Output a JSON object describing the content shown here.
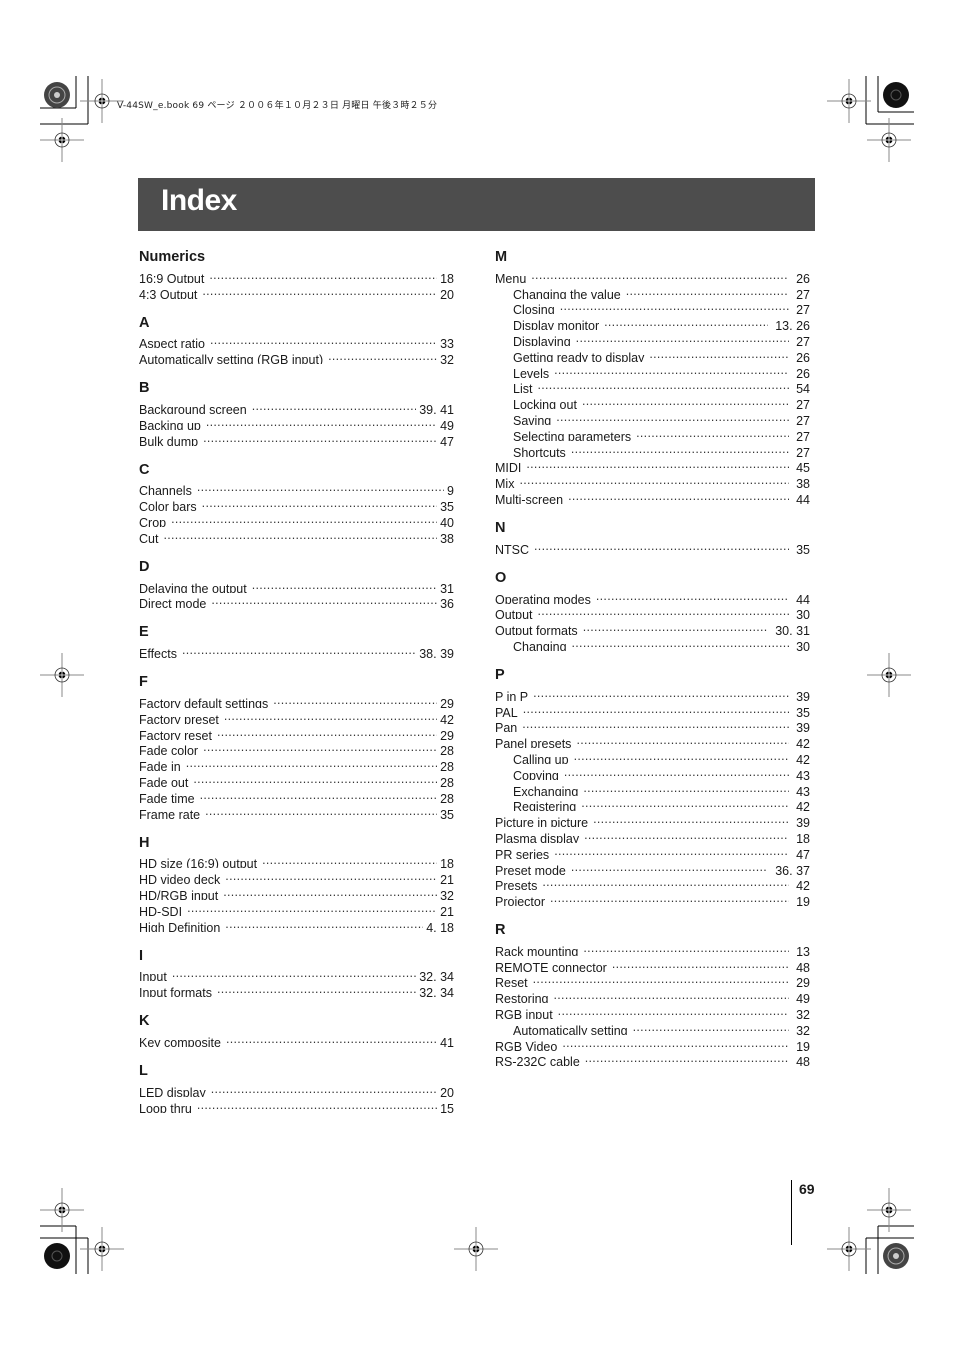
{
  "print_slug": "V-44SW_e.book  69 ページ  ２００６年１０月２３日  月曜日  午後３時２５分",
  "header": {
    "title": "Index"
  },
  "page_number": "69",
  "left_column": [
    {
      "heading": "Numerics",
      "entries": [
        {
          "term": "16:9 Output",
          "pages": "18",
          "sub": false
        },
        {
          "term": "4:3 Output",
          "pages": "20",
          "sub": false
        }
      ]
    },
    {
      "heading": "A",
      "entries": [
        {
          "term": "Aspect ratio",
          "pages": "33",
          "sub": false
        },
        {
          "term": "Automatically setting (RGB input)",
          "pages": "32",
          "sub": false
        }
      ]
    },
    {
      "heading": "B",
      "entries": [
        {
          "term": "Background screen",
          "pages": "39, 41",
          "sub": false
        },
        {
          "term": "Backing up",
          "pages": "49",
          "sub": false
        },
        {
          "term": "Bulk dump",
          "pages": "47",
          "sub": false
        }
      ]
    },
    {
      "heading": "C",
      "entries": [
        {
          "term": "Channels",
          "pages": "9",
          "sub": false
        },
        {
          "term": "Color bars",
          "pages": "35",
          "sub": false
        },
        {
          "term": "Crop",
          "pages": "40",
          "sub": false
        },
        {
          "term": "Cut",
          "pages": "38",
          "sub": false
        }
      ]
    },
    {
      "heading": "D",
      "entries": [
        {
          "term": "Delaying the output",
          "pages": "31",
          "sub": false
        },
        {
          "term": "Direct mode",
          "pages": "36",
          "sub": false
        }
      ]
    },
    {
      "heading": "E",
      "entries": [
        {
          "term": "Effects",
          "pages": "38, 39",
          "sub": false
        }
      ]
    },
    {
      "heading": "F",
      "entries": [
        {
          "term": "Factory default settings",
          "pages": "29",
          "sub": false
        },
        {
          "term": "Factory preset",
          "pages": "42",
          "sub": false
        },
        {
          "term": "Factory reset",
          "pages": "29",
          "sub": false
        },
        {
          "term": "Fade color",
          "pages": "28",
          "sub": false
        },
        {
          "term": "Fade in",
          "pages": "28",
          "sub": false
        },
        {
          "term": "Fade out",
          "pages": "28",
          "sub": false
        },
        {
          "term": "Fade time",
          "pages": "28",
          "sub": false
        },
        {
          "term": "Frame rate",
          "pages": "35",
          "sub": false
        }
      ]
    },
    {
      "heading": "H",
      "entries": [
        {
          "term": "HD size (16:9) output",
          "pages": "18",
          "sub": false
        },
        {
          "term": "HD video deck",
          "pages": "21",
          "sub": false
        },
        {
          "term": "HD/RGB input",
          "pages": "32",
          "sub": false
        },
        {
          "term": "HD-SDI",
          "pages": "21",
          "sub": false
        },
        {
          "term": "High Definition",
          "pages": "4, 18",
          "sub": false
        }
      ]
    },
    {
      "heading": "I",
      "entries": [
        {
          "term": "Input",
          "pages": "32, 34",
          "sub": false
        },
        {
          "term": "Input formats",
          "pages": "32, 34",
          "sub": false
        }
      ]
    },
    {
      "heading": "K",
      "entries": [
        {
          "term": "Key composite",
          "pages": "41",
          "sub": false
        }
      ]
    },
    {
      "heading": "L",
      "entries": [
        {
          "term": "LED display",
          "pages": "20",
          "sub": false
        },
        {
          "term": "Loop thru",
          "pages": "15",
          "sub": false
        }
      ]
    }
  ],
  "right_column": [
    {
      "heading": "M",
      "entries": [
        {
          "term": "Menu",
          "pages": "26",
          "sub": false
        },
        {
          "term": "Changing the value",
          "pages": "27",
          "sub": true
        },
        {
          "term": "Closing",
          "pages": "27",
          "sub": true
        },
        {
          "term": "Display monitor",
          "pages": "13, 26",
          "sub": true
        },
        {
          "term": "Displaying",
          "pages": "27",
          "sub": true
        },
        {
          "term": "Getting ready to display",
          "pages": "26",
          "sub": true
        },
        {
          "term": "Levels",
          "pages": "26",
          "sub": true
        },
        {
          "term": "List",
          "pages": "54",
          "sub": true
        },
        {
          "term": "Locking out",
          "pages": "27",
          "sub": true
        },
        {
          "term": "Saving",
          "pages": "27",
          "sub": true
        },
        {
          "term": "Selecting parameters",
          "pages": "27",
          "sub": true
        },
        {
          "term": "Shortcuts",
          "pages": "27",
          "sub": true
        },
        {
          "term": "MIDI",
          "pages": "45",
          "sub": false
        },
        {
          "term": "Mix",
          "pages": "38",
          "sub": false
        },
        {
          "term": "Multi-screen",
          "pages": "44",
          "sub": false
        }
      ]
    },
    {
      "heading": "N",
      "entries": [
        {
          "term": "NTSC",
          "pages": "35",
          "sub": false
        }
      ]
    },
    {
      "heading": "O",
      "entries": [
        {
          "term": "Operating modes",
          "pages": "44",
          "sub": false
        },
        {
          "term": "Output",
          "pages": "30",
          "sub": false
        },
        {
          "term": "Output formats",
          "pages": "30, 31",
          "sub": false
        },
        {
          "term": "Changing",
          "pages": "30",
          "sub": true
        }
      ]
    },
    {
      "heading": "P",
      "entries": [
        {
          "term": "P in P",
          "pages": "39",
          "sub": false
        },
        {
          "term": "PAL",
          "pages": "35",
          "sub": false
        },
        {
          "term": "Pan",
          "pages": "39",
          "sub": false
        },
        {
          "term": "Panel presets",
          "pages": "42",
          "sub": false
        },
        {
          "term": "Calling up",
          "pages": "42",
          "sub": true
        },
        {
          "term": "Copying",
          "pages": "43",
          "sub": true
        },
        {
          "term": "Exchanging",
          "pages": "43",
          "sub": true
        },
        {
          "term": "Registering",
          "pages": "42",
          "sub": true
        },
        {
          "term": "Picture in picture",
          "pages": "39",
          "sub": false
        },
        {
          "term": "Plasma display",
          "pages": "18",
          "sub": false
        },
        {
          "term": "PR series",
          "pages": "47",
          "sub": false
        },
        {
          "term": "Preset mode",
          "pages": "36, 37",
          "sub": false
        },
        {
          "term": "Presets",
          "pages": "42",
          "sub": false
        },
        {
          "term": "Projector",
          "pages": "19",
          "sub": false
        }
      ]
    },
    {
      "heading": "R",
      "entries": [
        {
          "term": "Rack mounting",
          "pages": "13",
          "sub": false
        },
        {
          "term": "REMOTE connector",
          "pages": "48",
          "sub": false
        },
        {
          "term": "Reset",
          "pages": "29",
          "sub": false
        },
        {
          "term": "Restoring",
          "pages": "49",
          "sub": false
        },
        {
          "term": "RGB input",
          "pages": "32",
          "sub": false
        },
        {
          "term": "Automatically setting",
          "pages": "32",
          "sub": true
        },
        {
          "term": "RGB Video",
          "pages": "19",
          "sub": false
        },
        {
          "term": "RS-232C cable",
          "pages": "48",
          "sub": false
        }
      ]
    }
  ],
  "colors": {
    "header_bar": "#4d4d4d",
    "header_text": "#ffffff",
    "body_text": "#1a1a1a"
  }
}
